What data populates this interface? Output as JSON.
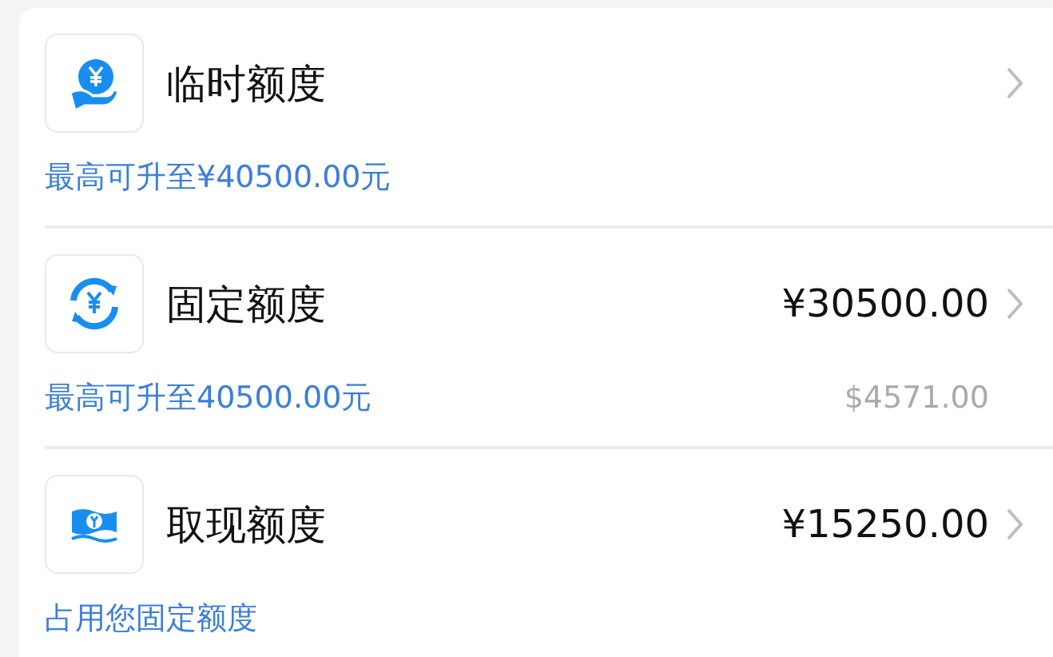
{
  "items": [
    {
      "kind": "hand",
      "title": "临时额度",
      "subtitle": "最高可升至¥40500.00元"
    },
    {
      "kind": "cycle",
      "title": "固定额度",
      "amount": "¥30500.00",
      "subtitle": "最高可升至40500.00元",
      "secondary": "$4571.00"
    },
    {
      "kind": "cash",
      "title": "取现额度",
      "amount": "¥15250.00",
      "subtitle": "占用您固定额度"
    }
  ]
}
